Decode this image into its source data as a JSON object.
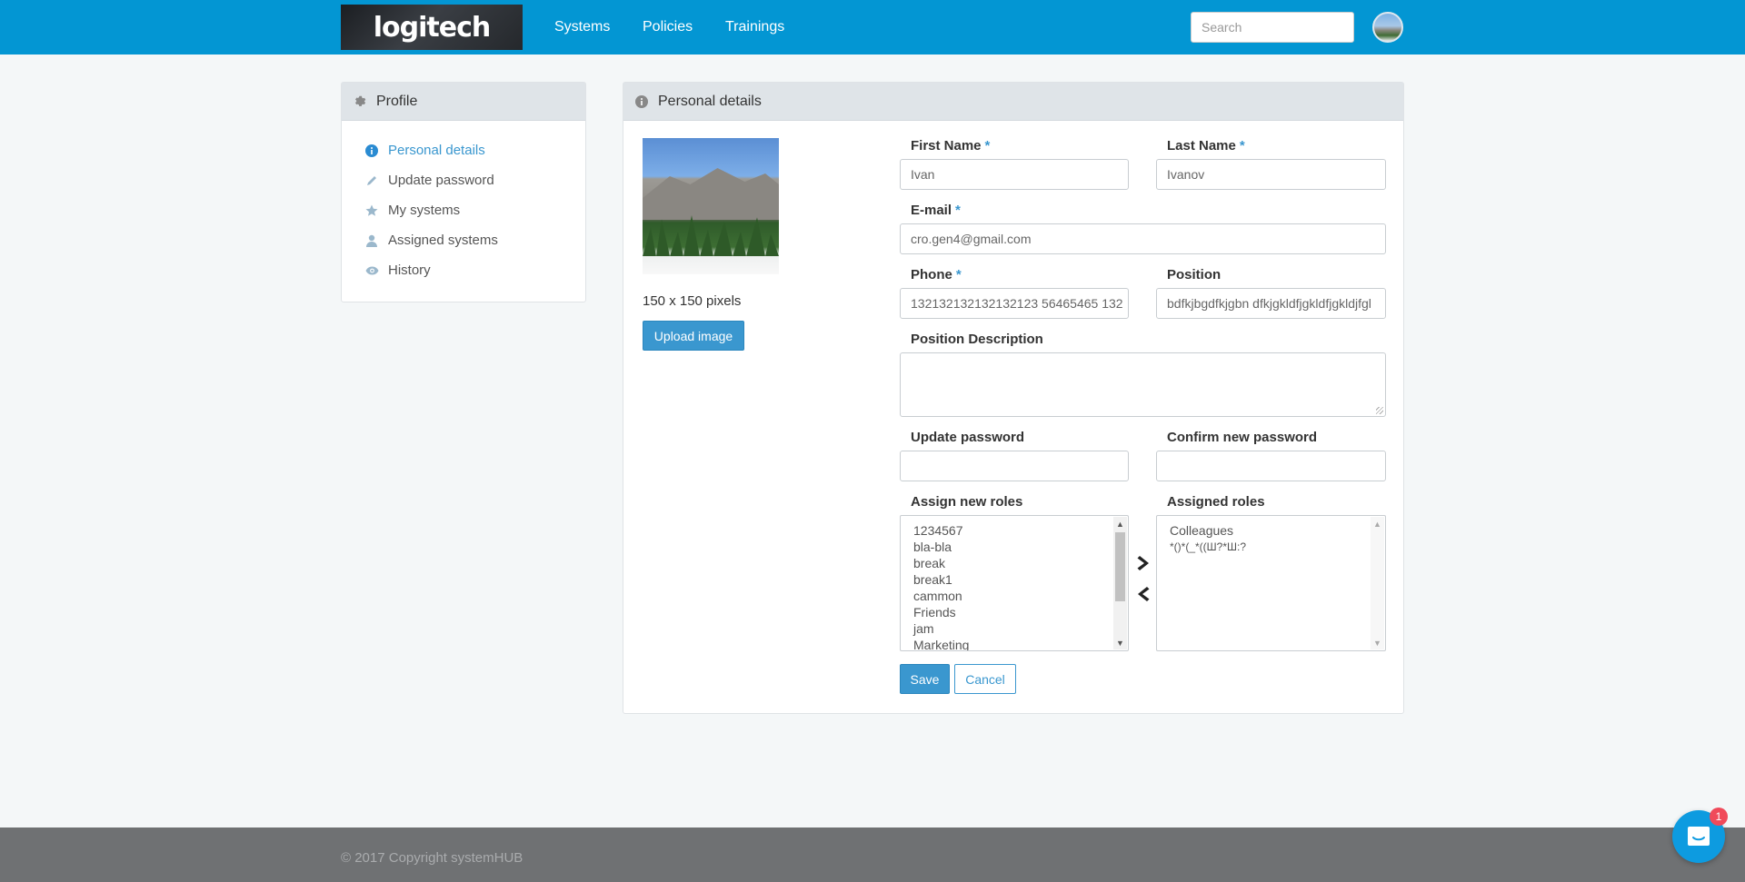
{
  "header": {
    "logo_text": "logitech",
    "nav": [
      "Systems",
      "Policies",
      "Trainings"
    ],
    "search_placeholder": "Search"
  },
  "sidebar": {
    "title": "Profile",
    "items": [
      {
        "label": "Personal details",
        "icon": "info-icon",
        "active": true
      },
      {
        "label": "Update password",
        "icon": "pencil-icon",
        "active": false
      },
      {
        "label": "My systems",
        "icon": "star-icon",
        "active": false
      },
      {
        "label": "Assigned systems",
        "icon": "user-icon",
        "active": false
      },
      {
        "label": "History",
        "icon": "eye-icon",
        "active": false
      }
    ]
  },
  "details": {
    "title": "Personal details",
    "photo_caption": "150 x 150 pixels",
    "upload_label": "Upload image",
    "first_name_label": "First Name",
    "first_name_value": "Ivan",
    "last_name_label": "Last Name",
    "last_name_value": "Ivanov",
    "email_label": "E-mail",
    "email_value": "cro.gen4@gmail.com",
    "phone_label": "Phone",
    "phone_value": "132132132132132123 56465465 132",
    "position_label": "Position",
    "position_value": "bdfkjbgdfkjgbn dfkjgkldfjgkldfjgkldjfgl",
    "position_desc_label": "Position Description",
    "position_desc_value": "",
    "update_password_label": "Update password",
    "confirm_password_label": "Confirm new password",
    "assign_roles_label": "Assign new roles",
    "assigned_roles_label": "Assigned roles",
    "available_roles": [
      "1234567",
      "bla-bla",
      "break",
      "break1",
      "cammon",
      "Friends",
      "jam",
      "Marketing"
    ],
    "assigned_roles": [
      "Colleagues",
      "*()*(_*((Ш?*Ш:?"
    ],
    "save_label": "Save",
    "cancel_label": "Cancel",
    "required_marker": "*"
  },
  "footer": {
    "copyright": "© 2017 Copyright systemHUB"
  },
  "chat": {
    "badge_count": "1"
  },
  "colors": {
    "navbar": "#0396d3",
    "accent": "#3a97cf",
    "footer": "#6f7173"
  }
}
